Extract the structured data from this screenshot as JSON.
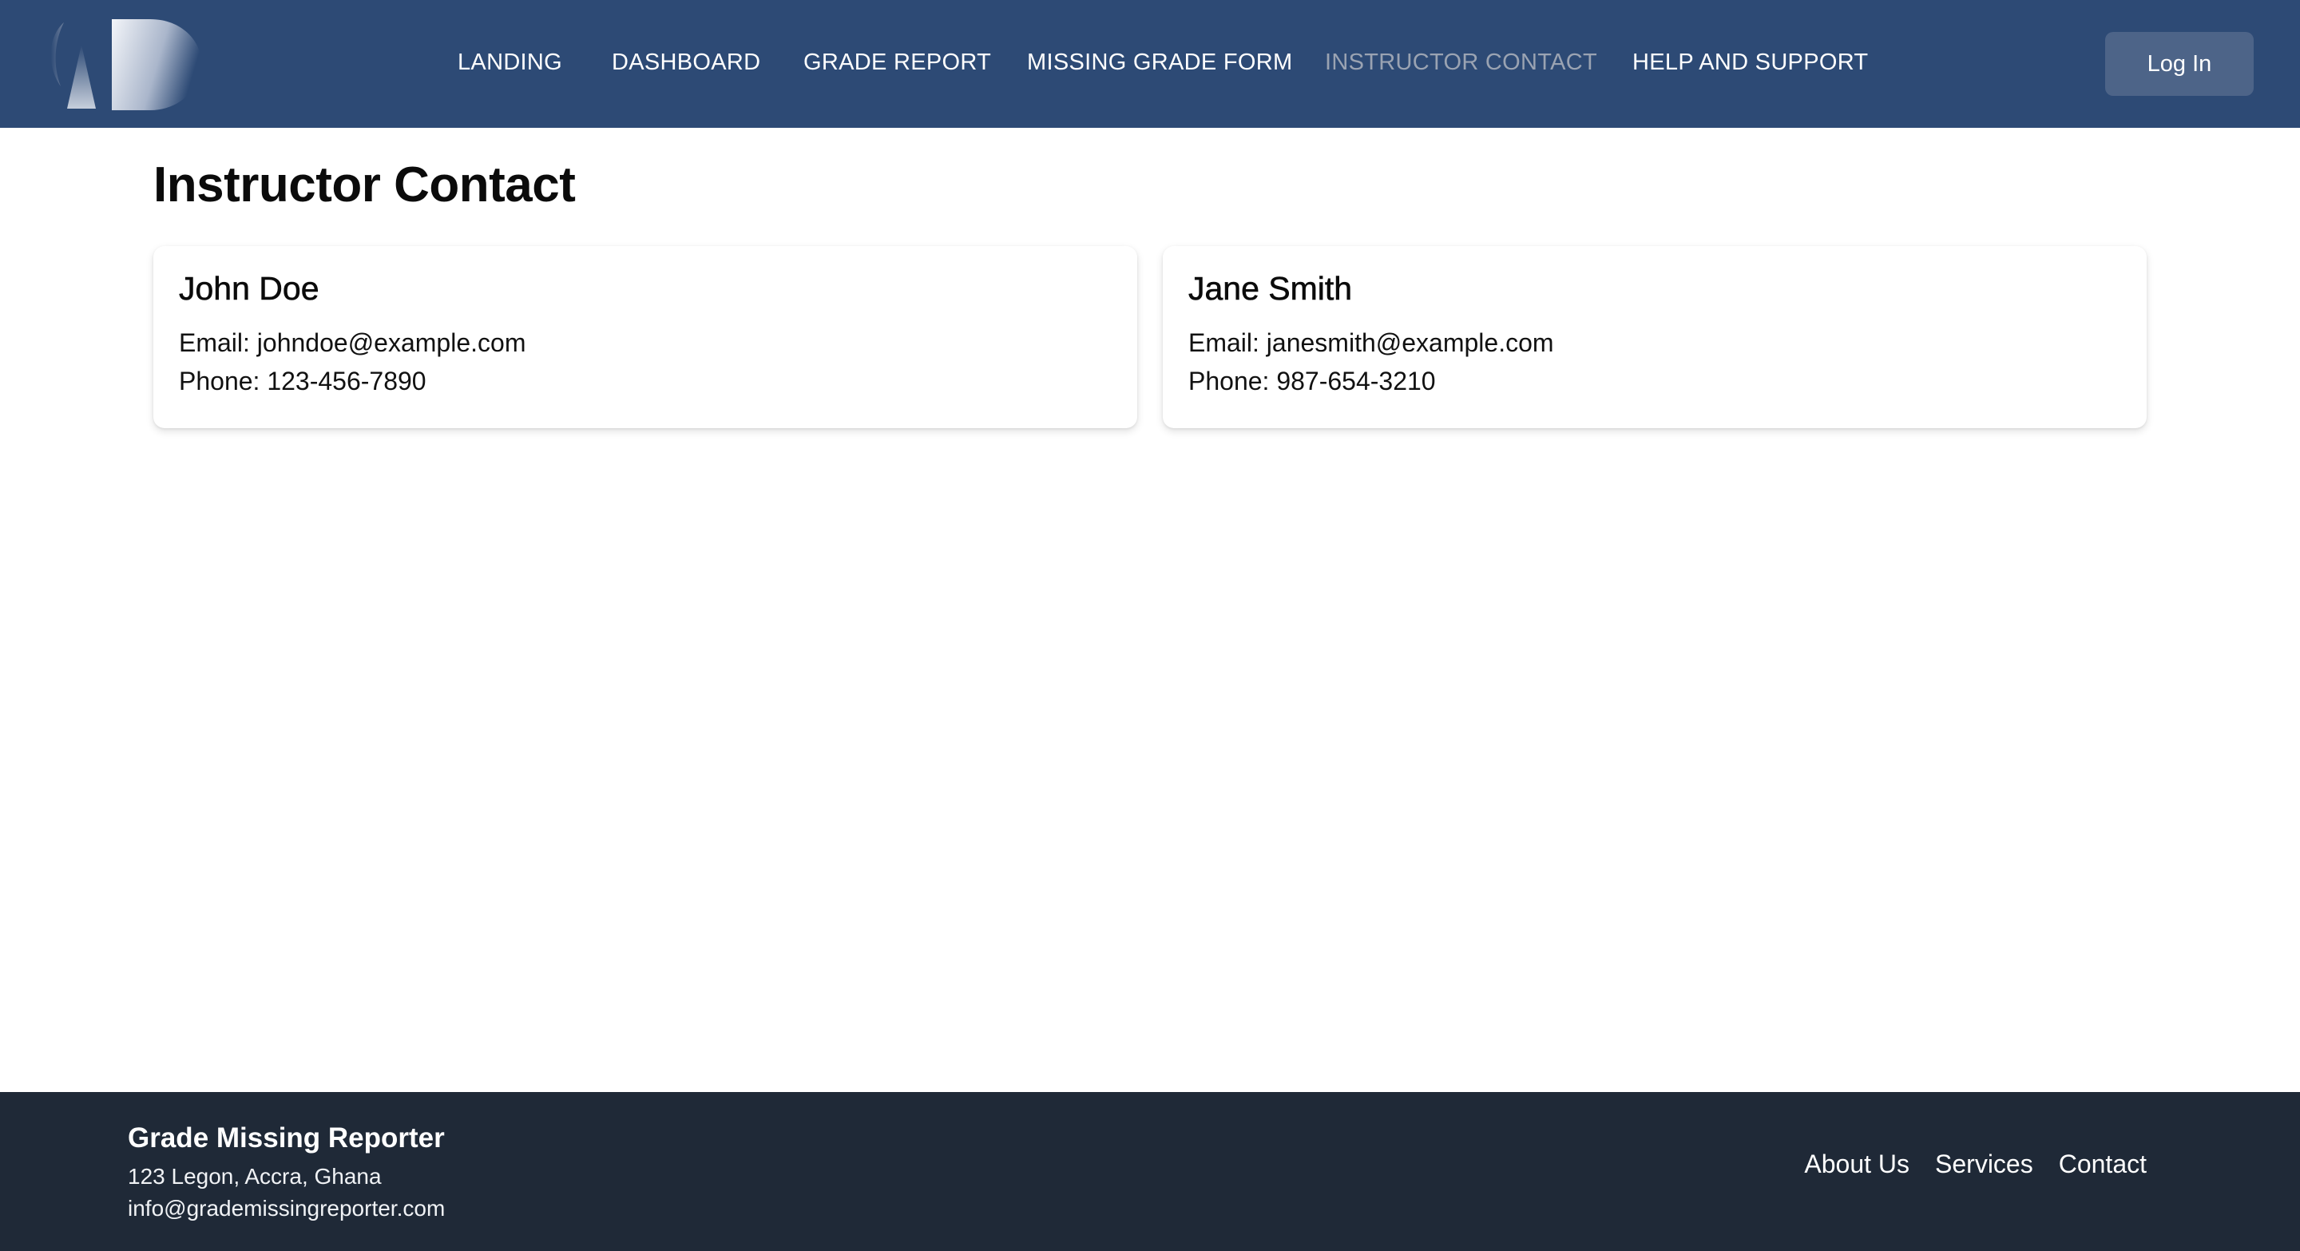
{
  "header": {
    "logo_icon": "app-logo",
    "nav": [
      {
        "label": "LANDING",
        "active": false
      },
      {
        "label": "DASHBOARD",
        "active": false
      },
      {
        "label": "GRADE REPORT",
        "active": false
      },
      {
        "label": "MISSING GRADE FORM",
        "active": false
      },
      {
        "label": "INSTRUCTOR CONTACT",
        "active": true
      },
      {
        "label": "HELP AND SUPPORT",
        "active": false
      }
    ],
    "login_label": "Log In"
  },
  "main": {
    "title": "Instructor Contact",
    "instructors": [
      {
        "name": "John Doe",
        "email": "Email: johndoe@example.com",
        "phone": "Phone: 123-456-7890"
      },
      {
        "name": "Jane Smith",
        "email": "Email: janesmith@example.com",
        "phone": "Phone: 987-654-3210"
      }
    ]
  },
  "footer": {
    "brand": "Grade Missing Reporter",
    "address": "123 Legon, Accra, Ghana",
    "email": "info@grademissingreporter.com",
    "links": [
      "About Us",
      "Services",
      "Contact"
    ]
  },
  "colors": {
    "header_bg": "#2d4a75",
    "footer_bg": "#1f2937",
    "active_nav": "#9aa3b2",
    "login_bg": "#4d6488"
  }
}
